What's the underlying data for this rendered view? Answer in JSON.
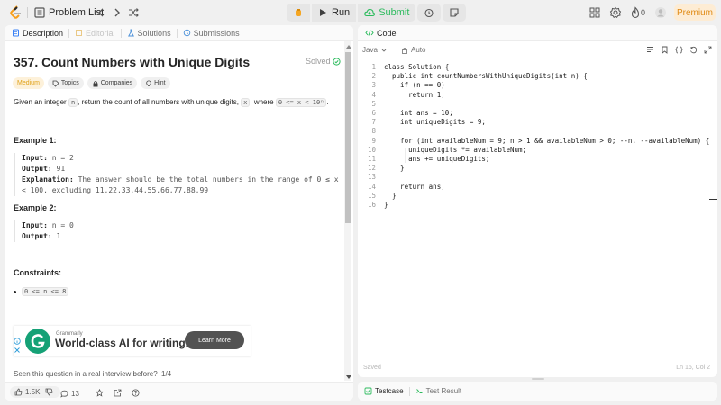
{
  "topbar": {
    "problem_list": "Problem List",
    "run": "Run",
    "submit": "Submit",
    "streak": "0",
    "premium": "Premium"
  },
  "tabs": [
    {
      "label": "Description"
    },
    {
      "label": "Editorial"
    },
    {
      "label": "Solutions"
    },
    {
      "label": "Submissions"
    }
  ],
  "problem": {
    "title": "357. Count Numbers with Unique Digits",
    "status": "Solved",
    "chips": {
      "difficulty": "Medium",
      "topics": "Topics",
      "companies": "Companies",
      "hint": "Hint"
    },
    "desc_pre": "Given an integer ",
    "desc_var": "n",
    "desc_mid": ", return the count of all numbers with unique digits, ",
    "desc_x": "x",
    "desc_post": ", where ",
    "desc_cond": "0 <= x < 10ⁿ",
    "desc_end": ".",
    "ex1_title": "Example 1:",
    "ex1_input_label": "Input:",
    "ex1_input": " n = 2",
    "ex1_output_label": "Output:",
    "ex1_output": " 91",
    "ex1_expl_label": "Explanation:",
    "ex1_expl1": " The answer should be the total numbers in the range of 0 ≤ x",
    "ex1_expl2": "< 100, excluding 11,22,33,44,55,66,77,88,99",
    "ex2_title": "Example 2:",
    "ex2_input_label": "Input:",
    "ex2_input": " n = 0",
    "ex2_output_label": "Output:",
    "ex2_output": " 1",
    "constraints_title": "Constraints:",
    "constraint1": "0 <= n <= 8"
  },
  "ad": {
    "brand": "Grammarly",
    "headline": "World-class AI for writing.",
    "cta": "Learn More"
  },
  "seen": {
    "question": "Seen this question in a real interview before?",
    "page": "1/4"
  },
  "footer": {
    "likes": "1.5K",
    "comments": "13"
  },
  "code_panel": {
    "title": "Code",
    "language": "Java",
    "mode": "Auto",
    "saved": "Saved",
    "cursor": "Ln 16, Col 2",
    "lines": [
      {
        "n": "1",
        "t": "class Solution {"
      },
      {
        "n": "2",
        "t": "  public int countNumbersWithUniqueDigits(int n) {"
      },
      {
        "n": "3",
        "t": "    if (n == 0)"
      },
      {
        "n": "4",
        "t": "      return 1;"
      },
      {
        "n": "5",
        "t": ""
      },
      {
        "n": "6",
        "t": "    int ans = 10;"
      },
      {
        "n": "7",
        "t": "    int uniqueDigits = 9;"
      },
      {
        "n": "8",
        "t": ""
      },
      {
        "n": "9",
        "t": "    for (int availableNum = 9; n > 1 && availableNum > 0; --n, --availableNum) {"
      },
      {
        "n": "10",
        "t": "      uniqueDigits *= availableNum;"
      },
      {
        "n": "11",
        "t": "      ans += uniqueDigits;"
      },
      {
        "n": "12",
        "t": "    }"
      },
      {
        "n": "13",
        "t": ""
      },
      {
        "n": "14",
        "t": "    return ans;"
      },
      {
        "n": "15",
        "t": "  }"
      },
      {
        "n": "16",
        "t": "}"
      }
    ]
  },
  "testcase": {
    "tab1": "Testcase",
    "tab2": "Test Result"
  },
  "colors": {
    "accent": "#2cbb5d",
    "medium": "#e0a118",
    "premium": "#e08a14"
  }
}
